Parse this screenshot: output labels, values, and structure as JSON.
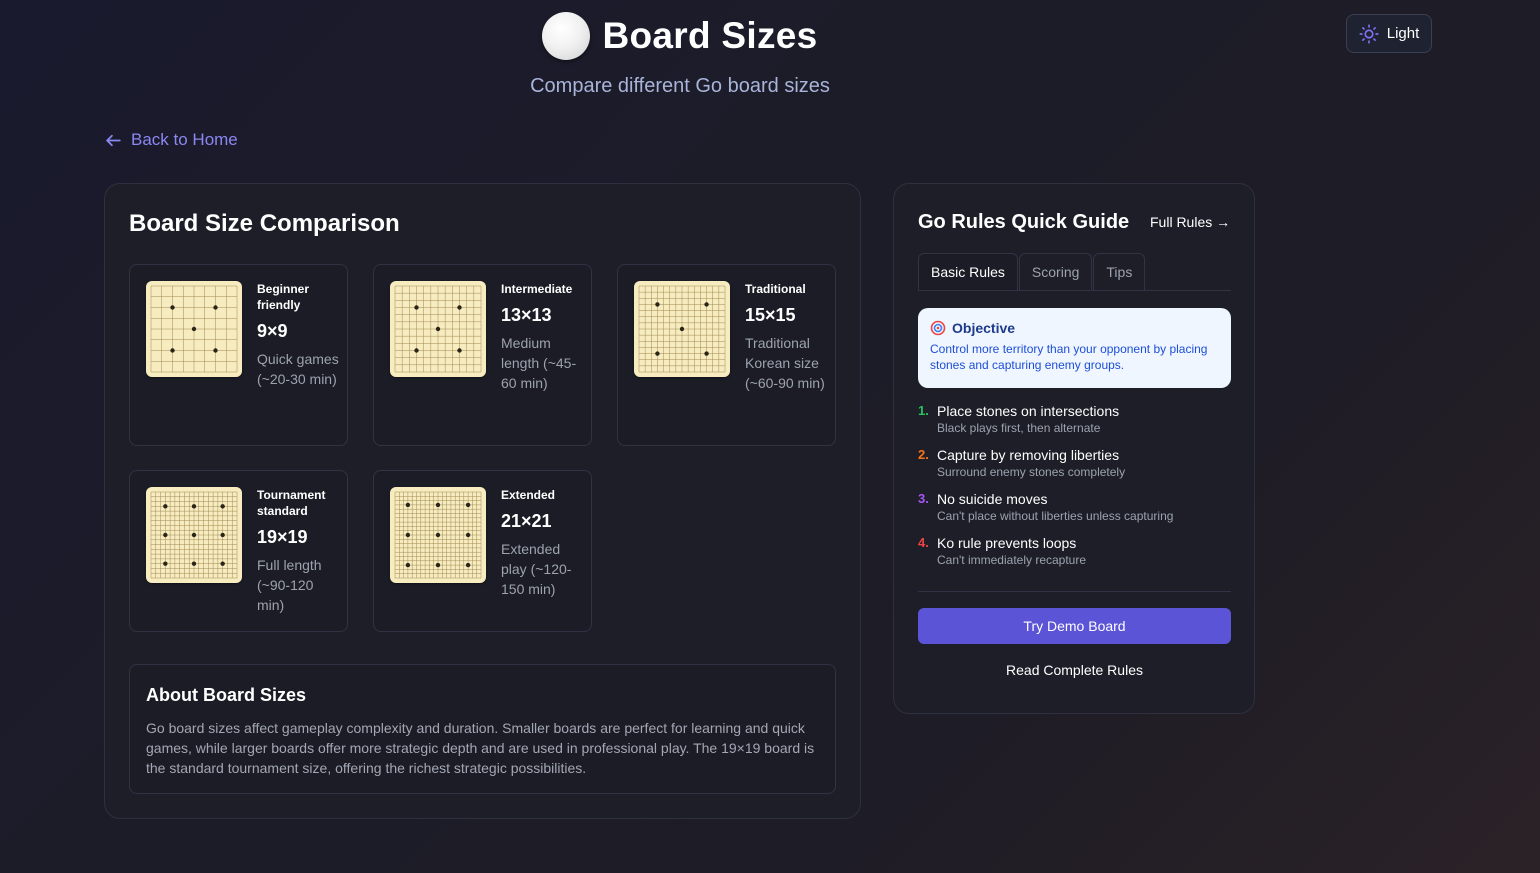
{
  "header": {
    "title": "Board Sizes",
    "subtitle": "Compare different Go board sizes",
    "theme_toggle_label": "Light",
    "back_link_label": "Back to Home"
  },
  "comparison": {
    "heading": "Board Size Comparison",
    "boards": [
      {
        "tag": "Beginner friendly",
        "size": "9×9",
        "lines": 9,
        "description": "Quick games (~20-30 min)"
      },
      {
        "tag": "Intermediate",
        "size": "13×13",
        "lines": 13,
        "description": "Medium length (~45-60 min)"
      },
      {
        "tag": "Traditional",
        "size": "15×15",
        "lines": 15,
        "description": "Traditional Korean size (~60-90 min)"
      },
      {
        "tag": "Tournament standard",
        "size": "19×19",
        "lines": 19,
        "description": "Full length (~90-120 min)"
      },
      {
        "tag": "Extended",
        "size": "21×21",
        "lines": 21,
        "description": "Extended play (~120-150 min)"
      }
    ],
    "about": {
      "heading": "About Board Sizes",
      "text": "Go board sizes affect gameplay complexity and duration. Smaller boards are perfect for learning and quick games, while larger boards offer more strategic depth and are used in professional play. The 19×19 board is the standard tournament size, offering the richest strategic possibilities."
    }
  },
  "guide": {
    "title": "Go Rules Quick Guide",
    "full_rules_link": "Full Rules →",
    "tabs": [
      "Basic Rules",
      "Scoring",
      "Tips"
    ],
    "active_tab": "Basic Rules",
    "objective": {
      "icon": "target-icon",
      "title": "Objective",
      "text": "Control more territory than your opponent by placing stones and capturing enemy groups."
    },
    "rules": [
      {
        "num": "1.",
        "title": "Place stones on intersections",
        "sub": "Black plays first, then alternate",
        "color": "#22c55e"
      },
      {
        "num": "2.",
        "title": "Capture by removing liberties",
        "sub": "Surround enemy stones completely",
        "color": "#f97316"
      },
      {
        "num": "3.",
        "title": "No suicide moves",
        "sub": "Can't place without liberties unless capturing",
        "color": "#a855f7"
      },
      {
        "num": "4.",
        "title": "Ko rule prevents loops",
        "sub": "Can't immediately recapture",
        "color": "#ef4444"
      }
    ],
    "demo_button": "Try Demo Board",
    "read_rules_link": "Read Complete Rules"
  },
  "colors": {
    "accent": "#5b54d6",
    "link": "#8b87f0",
    "board_wood": "#f7ecc0"
  }
}
